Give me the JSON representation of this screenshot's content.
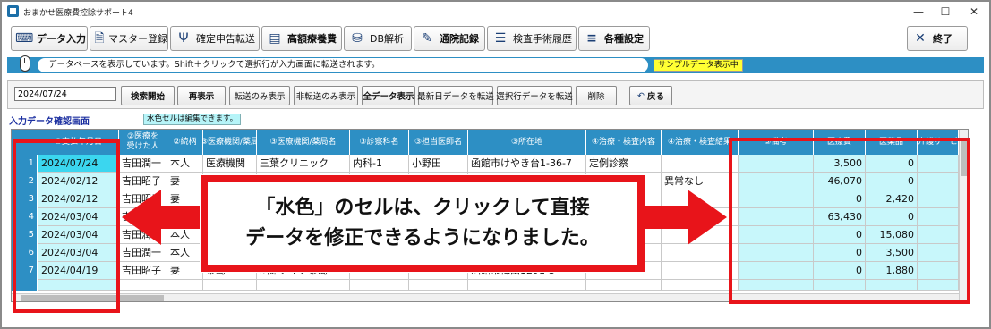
{
  "window": {
    "title": "おまかせ医療費控除サポート4",
    "controls": [
      "—",
      "☐",
      "✕"
    ]
  },
  "toolbar": {
    "buttons": [
      {
        "label": "データ入力",
        "icon": "keyboard-icon"
      },
      {
        "label": "マスター登録",
        "icon": "document-icon"
      },
      {
        "label": "確定申告転送",
        "icon": "usb-icon"
      },
      {
        "label": "高額療養費",
        "icon": "form-icon"
      },
      {
        "label": "DB解析",
        "icon": "database-icon"
      },
      {
        "label": "通院記録",
        "icon": "notebook-icon"
      },
      {
        "label": "検査手術履歴",
        "icon": "list-icon"
      },
      {
        "label": "各種設定",
        "icon": "menu-icon"
      }
    ],
    "exit_label": "終了"
  },
  "status": {
    "message": "データベースを表示しています。Shift＋クリックで選択行が入力画面に転送されます。",
    "sample_badge": "サンプルデータ表示中"
  },
  "filters": {
    "date_value": "2024/07/24",
    "buttons": [
      "検索開始",
      "再表示",
      "転送のみ表示",
      "非転送のみ表示",
      "全データ表示",
      "最新日データを転送",
      "選択行データを転送",
      "削除",
      "戻る"
    ]
  },
  "section": {
    "title": "入力データ確認画面",
    "hint": "水色セルは編集できます。"
  },
  "grid": {
    "headers": [
      "①支払年月日",
      "②医療を\n受けた人",
      "②続柄",
      "③医療機関/薬局",
      "③医療機関/薬局名",
      "③診察科名",
      "③担当医師名",
      "③所在地",
      "④治療・検査内容",
      "④治療・検査結果",
      "⑤備考",
      "医療費",
      "医薬品",
      "介護サービ"
    ],
    "rows": [
      {
        "no": "1",
        "date": "2024/07/24",
        "person": "吉田潤一",
        "rel": "本人",
        "type": "医療機関",
        "name": "三葉クリニック",
        "dept": "内科-1",
        "doctor": "小野田",
        "addr": "函館市けやき台1-36-7",
        "treat": "定例診察",
        "result": "",
        "note": "",
        "fee": "3,500",
        "med": "0"
      },
      {
        "no": "2",
        "date": "2024/02/12",
        "person": "吉田昭子",
        "rel": "妻",
        "type": "",
        "name": "",
        "dept": "",
        "doctor": "",
        "addr": "",
        "treat": "",
        "result": "異常なし",
        "note": "",
        "fee": "46,070",
        "med": "0"
      },
      {
        "no": "3",
        "date": "2024/02/12",
        "person": "吉田昭子",
        "rel": "妻",
        "type": "",
        "name": "",
        "dept": "",
        "doctor": "",
        "addr": "",
        "treat": "",
        "result": "",
        "note": "",
        "fee": "0",
        "med": "2,420"
      },
      {
        "no": "4",
        "date": "2024/03/04",
        "person": "吉田潤一",
        "rel": "",
        "type": "",
        "name": "",
        "dept": "",
        "doctor": "",
        "addr": "",
        "treat": "",
        "result": "",
        "note": "",
        "fee": "63,430",
        "med": "0"
      },
      {
        "no": "5",
        "date": "2024/03/04",
        "person": "吉田潤一",
        "rel": "本人",
        "type": "",
        "name": "",
        "dept": "",
        "doctor": "",
        "addr": "",
        "treat": "",
        "result": "",
        "note": "",
        "fee": "0",
        "med": "15,080"
      },
      {
        "no": "6",
        "date": "2024/03/04",
        "person": "吉田潤一",
        "rel": "本人",
        "type": "",
        "name": "",
        "dept": "",
        "doctor": "",
        "addr": "",
        "treat": "",
        "result": "",
        "note": "",
        "fee": "0",
        "med": "3,500"
      },
      {
        "no": "7",
        "date": "2024/04/19",
        "person": "吉田昭子",
        "rel": "妻",
        "type": "薬局",
        "name": "函館アイク薬局",
        "dept": "",
        "doctor": "",
        "addr": "函館市梅田1291-3",
        "treat": "",
        "result": "",
        "note": "",
        "fee": "0",
        "med": "1,880"
      }
    ]
  },
  "callout": {
    "line1": "「水色」のセルは、クリックして直接",
    "line2": "データを修正できるようになりました。"
  },
  "colors": {
    "accent": "#2d8fc4",
    "cyan_cell": "#c8f7fb",
    "selected_cell": "#3bd6ef",
    "annotation_red": "#e8141a"
  }
}
